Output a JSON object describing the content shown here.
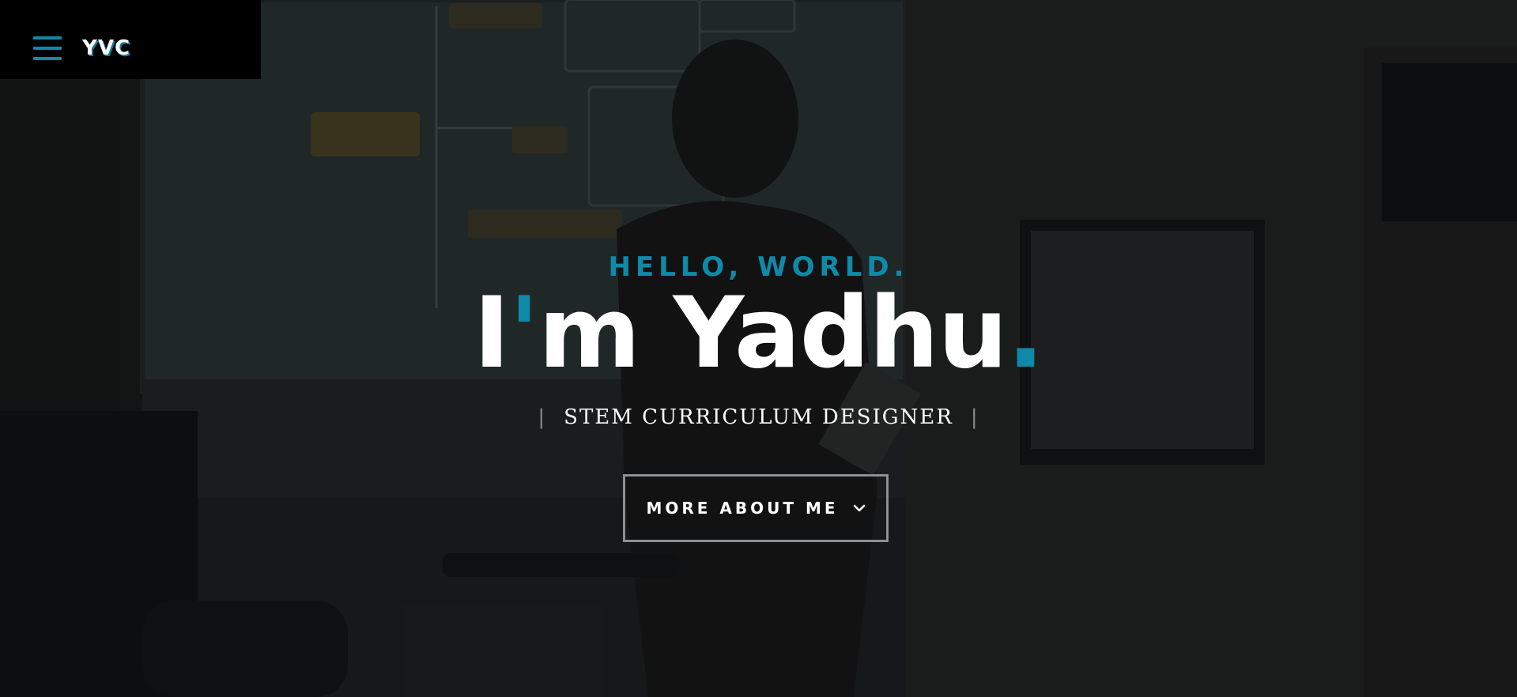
{
  "header": {
    "logo_text": "YVC",
    "menu_icon": "hamburger-menu-icon"
  },
  "hero": {
    "greeting": "HELLO, WORLD.",
    "name_prefix": "I",
    "name_apostrophe": "'",
    "name_main": "m Yadhu",
    "name_dot": ".",
    "role": "STEM CURRICULUM DESIGNER",
    "role_separator": "|",
    "cta_label": "MORE ABOUT ME",
    "cta_icon": "chevron-down-icon"
  },
  "colors": {
    "accent": "#0e8aa8",
    "header_bg": "#000000",
    "text": "#ffffff",
    "button_border": "#8e8f90"
  }
}
